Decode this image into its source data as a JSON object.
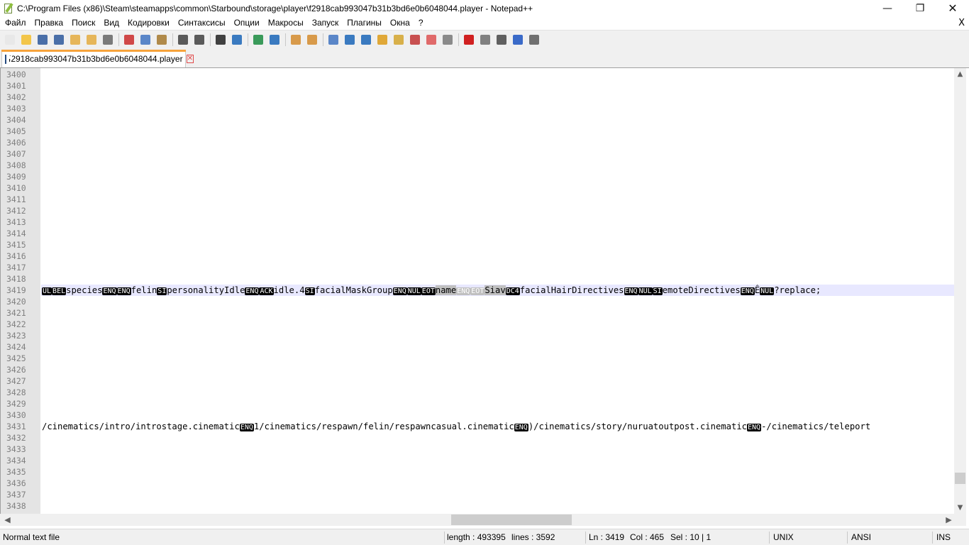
{
  "window": {
    "title": "C:\\Program Files (x86)\\Steam\\steamapps\\common\\Starbound\\storage\\player\\f2918cab993047b31b3bd6e0b6048044.player - Notepad++",
    "minimize_glyph": "—",
    "maximize_glyph": "❐",
    "close_glyph": "✕"
  },
  "menu": {
    "items": [
      "Файл",
      "Правка",
      "Поиск",
      "Вид",
      "Кодировки",
      "Синтаксисы",
      "Опции",
      "Макросы",
      "Запуск",
      "Плагины",
      "Окна",
      "?"
    ],
    "close_glyph": "X"
  },
  "toolbar": {
    "buttons": [
      {
        "icon": "new-file-icon",
        "color": "#e8e8e8"
      },
      {
        "icon": "open-file-icon",
        "color": "#f3c64a"
      },
      {
        "icon": "save-icon",
        "color": "#4a6fa8"
      },
      {
        "icon": "save-all-icon",
        "color": "#4a6fa8"
      },
      {
        "icon": "close-icon",
        "color": "#e6b65a"
      },
      {
        "icon": "close-all-icon",
        "color": "#e6b65a"
      },
      {
        "icon": "print-icon",
        "color": "#7a7a7a"
      },
      {
        "sep": true
      },
      {
        "icon": "cut-icon",
        "color": "#d04848"
      },
      {
        "icon": "copy-icon",
        "color": "#5a86c8"
      },
      {
        "icon": "paste-icon",
        "color": "#b08a4a"
      },
      {
        "sep": true
      },
      {
        "icon": "undo-icon",
        "color": "#5a5a5a"
      },
      {
        "icon": "redo-icon",
        "color": "#5a5a5a"
      },
      {
        "sep": true
      },
      {
        "icon": "find-icon",
        "color": "#404040"
      },
      {
        "icon": "replace-icon",
        "color": "#3a7ac0"
      },
      {
        "sep": true
      },
      {
        "icon": "zoom-in-icon",
        "color": "#3a9a5a"
      },
      {
        "icon": "zoom-out-icon",
        "color": "#3a7ac0"
      },
      {
        "sep": true
      },
      {
        "icon": "sync-vertical-icon",
        "color": "#d89a4a"
      },
      {
        "icon": "sync-horizontal-icon",
        "color": "#d89a4a"
      },
      {
        "sep": true
      },
      {
        "icon": "word-wrap-icon",
        "color": "#5a86c8"
      },
      {
        "icon": "show-all-chars-icon",
        "color": "#3a7ac0"
      },
      {
        "icon": "indent-guide-icon",
        "color": "#3a7ac0"
      },
      {
        "icon": "udl-icon",
        "color": "#e0a838"
      },
      {
        "icon": "doc-map-icon",
        "color": "#d8b04a"
      },
      {
        "icon": "function-list-icon",
        "color": "#c85050"
      },
      {
        "icon": "folder-workspace-icon",
        "color": "#e06a6a"
      },
      {
        "icon": "monitoring-icon",
        "color": "#8a8a8a"
      },
      {
        "sep": true
      },
      {
        "icon": "record-macro-icon",
        "color": "#d02020"
      },
      {
        "icon": "stop-record-icon",
        "color": "#808080"
      },
      {
        "icon": "playback-macro-icon",
        "color": "#606060"
      },
      {
        "icon": "run-macro-multiple-icon",
        "color": "#3a6ac8"
      },
      {
        "icon": "save-macro-icon",
        "color": "#707070"
      }
    ]
  },
  "tab": {
    "label": "f2918cab993047b31b3bd6e0b6048044.player",
    "close_glyph": "✕"
  },
  "editor": {
    "line_numbers": [
      "3400",
      "3401",
      "3402",
      "3403",
      "3404",
      "3405",
      "3406",
      "3407",
      "3408",
      "3409",
      "3410",
      "3411",
      "3412",
      "3413",
      "3414",
      "3415",
      "3416",
      "3417",
      "3418",
      "3419",
      "3420",
      "3421",
      "3422",
      "3423",
      "3424",
      "3425",
      "3426",
      "3427",
      "3428",
      "3429",
      "3430",
      "3431",
      "3432",
      "3433",
      "3434",
      "3435",
      "3436",
      "3437",
      "3438"
    ],
    "current_line": "3419",
    "line_3419": [
      {
        "t": "UL",
        "c": true
      },
      {
        "t": "BEL",
        "c": true
      },
      {
        "t": "species"
      },
      {
        "t": "ENQ",
        "c": true
      },
      {
        "t": "ENQ",
        "c": true
      },
      {
        "t": "felin"
      },
      {
        "t": "SI",
        "c": true
      },
      {
        "t": "personalityIdle"
      },
      {
        "t": "ENQ",
        "c": true
      },
      {
        "t": "ACK",
        "c": true
      },
      {
        "t": "idle.4"
      },
      {
        "t": "SI",
        "c": true
      },
      {
        "t": "facialMaskGroup"
      },
      {
        "t": "ENQ",
        "c": true
      },
      {
        "t": "NUL",
        "c": true
      },
      {
        "t": "EOT",
        "c": true
      },
      {
        "t": "name",
        "s": true
      },
      {
        "t": "ENQ",
        "c": true,
        "s": true
      },
      {
        "t": "EOT",
        "c": true,
        "s": true
      },
      {
        "t": "Siav",
        "s": true
      },
      {
        "t": "DC4",
        "c": true
      },
      {
        "t": "facialHairDirectives"
      },
      {
        "t": "ENQ",
        "c": true
      },
      {
        "t": "NUL",
        "c": true
      },
      {
        "t": "SI",
        "c": true
      },
      {
        "t": "emoteDirectives"
      },
      {
        "t": "ENQ",
        "c": true
      },
      {
        "t": "Ê"
      },
      {
        "t": "NUL",
        "c": true
      },
      {
        "t": "?replace;"
      }
    ],
    "line_3431": [
      {
        "t": "/cinematics/intro/introstage.cinematic"
      },
      {
        "t": "ENQ",
        "c": true
      },
      {
        "t": "1/cinematics/respawn/felin/respawncasual.cinematic"
      },
      {
        "t": "ENQ",
        "c": true
      },
      {
        "t": ")/cinematics/story/nuruatoutpost.cinematic"
      },
      {
        "t": "ENQ",
        "c": true
      },
      {
        "t": "-/cinematics/teleport"
      }
    ]
  },
  "statusbar": {
    "file_type": "Normal text file",
    "length": "length : 493395",
    "lines": "lines : 3592",
    "ln": "Ln : 3419",
    "col": "Col : 465",
    "sel": "Sel : 10 | 1",
    "eol": "UNIX",
    "encoding": "ANSI",
    "mode": "INS"
  }
}
